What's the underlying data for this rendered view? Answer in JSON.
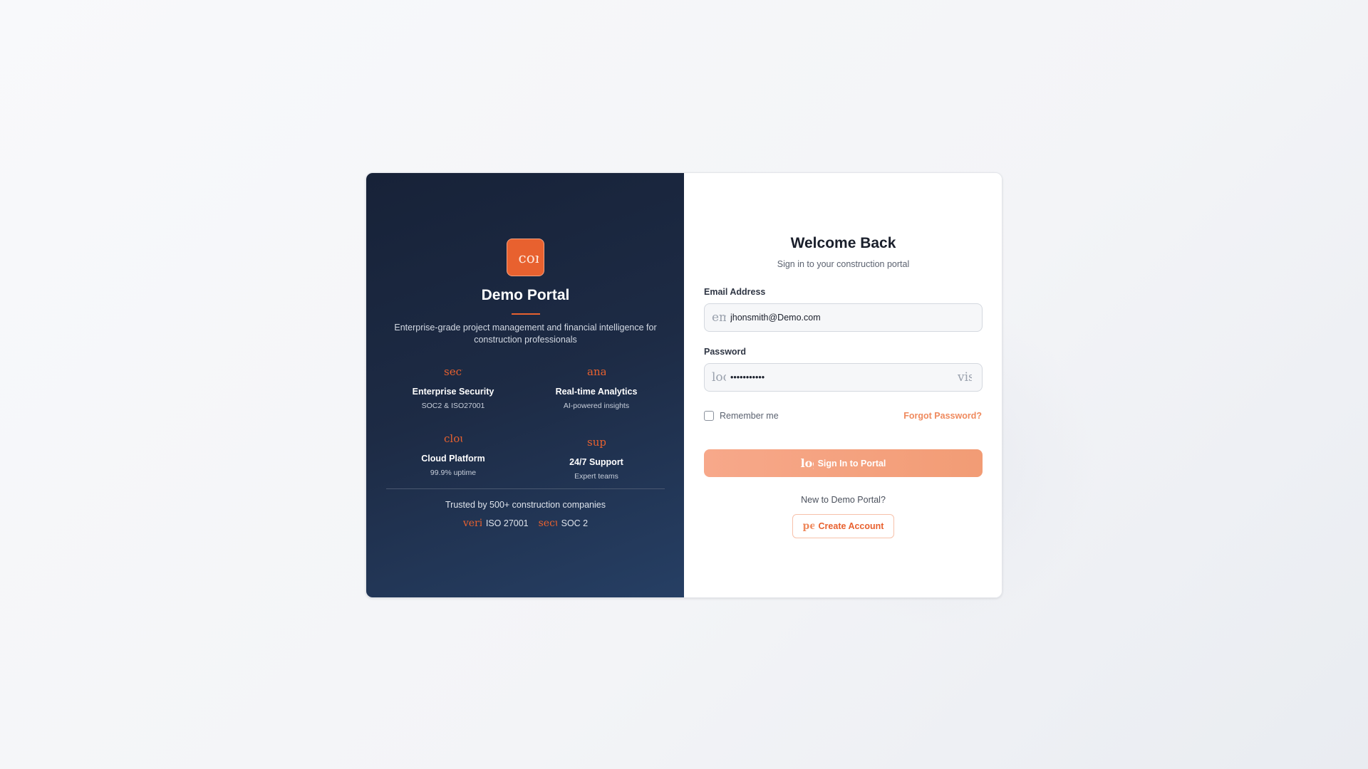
{
  "brand": {
    "logo_icon": "construction-icon",
    "logo_glyph": "construction",
    "title": "Demo Portal",
    "description": "Enterprise-grade project management and financial intelligence for construction professionals",
    "accent_color": "#e8612f"
  },
  "features": [
    {
      "icon": "security-icon",
      "glyph": "security",
      "title": "Enterprise Security",
      "subtitle": "SOC2 & ISO27001"
    },
    {
      "icon": "analytics-icon",
      "glyph": "analytics",
      "title": "Real-time Analytics",
      "subtitle": "AI-powered insights"
    },
    {
      "icon": "cloud-icon",
      "glyph": "cloud",
      "title": "Cloud Platform",
      "subtitle": "99.9% uptime"
    },
    {
      "icon": "support-icon",
      "glyph": "support",
      "title": "24/7 Support",
      "subtitle": "Expert teams"
    }
  ],
  "trust": {
    "text": "Trusted by 500+ construction companies",
    "badges": [
      {
        "icon": "verified-icon",
        "glyph": "verified",
        "label": "ISO 27001"
      },
      {
        "icon": "security-icon",
        "glyph": "security",
        "label": "SOC 2"
      }
    ]
  },
  "login": {
    "title": "Welcome Back",
    "subtitle": "Sign in to your construction portal",
    "email_label": "Email Address",
    "email_icon": "email-icon",
    "email_glyph": "email",
    "email_value": "jhonsmith@Demo.com",
    "password_label": "Password",
    "password_icon": "lock-icon",
    "password_glyph": "lock",
    "password_value": "•••••••••••",
    "visibility_icon": "visibility-icon",
    "visibility_glyph": "visibility",
    "remember_label": "Remember me",
    "remember_checked": false,
    "forgot_label": "Forgot Password?",
    "signin_icon": "login-icon",
    "signin_glyph": "login",
    "signin_label": "Sign In to Portal",
    "new_text": "New to Demo Portal?",
    "create_icon": "person-add-icon",
    "create_glyph": "person_add",
    "create_label": "Create Account"
  }
}
